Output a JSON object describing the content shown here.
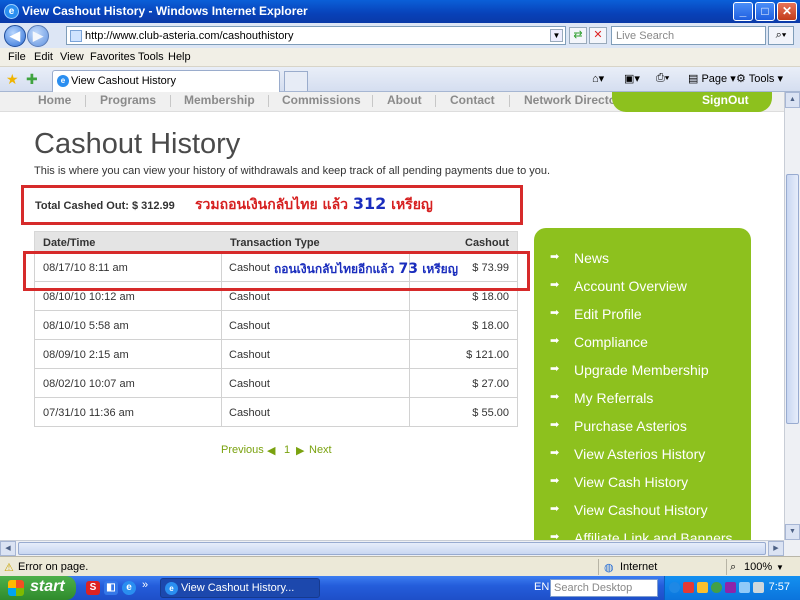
{
  "window": {
    "title": "View Cashout History - Windows Internet Explorer",
    "controls": {
      "minimize": "_",
      "maximize": "□",
      "close": "✕"
    }
  },
  "address_bar": {
    "url": "http://www.club-asteria.com/cashouthistory",
    "search_placeholder": "Live Search"
  },
  "menu": [
    "File",
    "Edit",
    "View",
    "Favorites",
    "Tools",
    "Help"
  ],
  "tab": {
    "label": "View Cashout History"
  },
  "toolbar": {
    "page_label": "Page",
    "tools_label": "Tools"
  },
  "site_nav": {
    "items": [
      "Home",
      "Programs",
      "Membership",
      "Commissions",
      "About",
      "Contact",
      "Network Director"
    ],
    "signout": "SignOut"
  },
  "page": {
    "title": "Cashout History",
    "description": "This is where you can view your history of withdrawals and keep track of all pending payments due to you.",
    "total_label": "Total Cashed Out: $ 312.99"
  },
  "annotations": {
    "total_note_prefix": "รวมถอนเงินกลับไทย แล้ว",
    "total_note_number": "312",
    "total_note_suffix": "เหรียญ",
    "row_note_prefix": "ถอนเงินกลับไทยอีกแล้ว",
    "row_note_number": "73",
    "row_note_suffix": "เหรียญ"
  },
  "table": {
    "headers": [
      "Date/Time",
      "Transaction Type",
      "Cashout"
    ],
    "rows": [
      [
        "08/17/10 8:11 am",
        "Cashout",
        "$ 73.99"
      ],
      [
        "08/10/10 10:12 am",
        "Cashout",
        "$ 18.00"
      ],
      [
        "08/10/10 5:58 am",
        "Cashout",
        "$ 18.00"
      ],
      [
        "08/09/10 2:15 am",
        "Cashout",
        "$ 121.00"
      ],
      [
        "08/02/10 10:07 am",
        "Cashout",
        "$ 27.00"
      ],
      [
        "07/31/10 11:36 am",
        "Cashout",
        "$ 55.00"
      ]
    ]
  },
  "pager": {
    "previous": "Previous",
    "page": "1",
    "next": "Next"
  },
  "sidebar": {
    "items": [
      "News",
      "Account Overview",
      "Edit Profile",
      "Compliance",
      "Upgrade Membership",
      "My Referrals",
      "Purchase Asterios",
      "View Asterios History",
      "View Cash History",
      "View Cashout History",
      "Affiliate Link and Banners"
    ]
  },
  "status": {
    "text": "Error on page.",
    "zone": "Internet",
    "zoom": "100%"
  },
  "taskbar": {
    "start": "start",
    "task": "View Cashout History...",
    "lang": "EN",
    "search_placeholder": "Search Desktop",
    "clock": "7:57"
  },
  "colors": {
    "accent_green": "#8dc11e",
    "annotation_red": "#d62a2a",
    "annotation_blue": "#1a2dbd"
  }
}
